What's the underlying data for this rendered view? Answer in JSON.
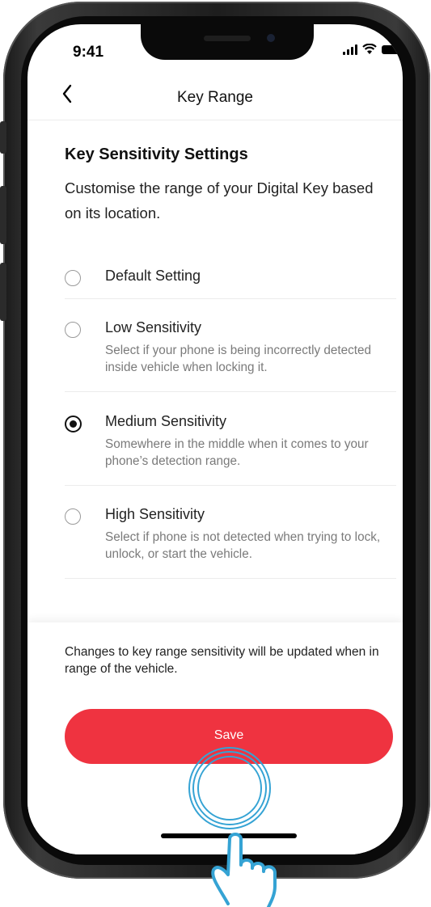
{
  "status_bar": {
    "time": "9:41"
  },
  "header": {
    "back_icon": "chevron-left-icon",
    "title": "Key Range"
  },
  "section": {
    "title": "Key Sensitivity Settings",
    "description": "Customise the range of your Digital Key based on its location."
  },
  "options": [
    {
      "title": "Default Setting",
      "description": "",
      "selected": false
    },
    {
      "title": "Low Sensitivity",
      "description": "Select if your phone is being incorrectly detected inside vehicle when locking it.",
      "selected": false
    },
    {
      "title": "Medium Sensitivity",
      "description": "Somewhere in the middle when it comes to your phone’s detection range.",
      "selected": true
    },
    {
      "title": "High Sensitivity",
      "description": "Select if phone is not detected when trying to lock, unlock, or start the vehicle.",
      "selected": false
    }
  ],
  "footer": {
    "note": "Changes to key range sensitivity will be updated when in range of the vehicle.",
    "save_label": "Save"
  },
  "colors": {
    "accent": "#ef3340",
    "touch_highlight": "#35a3d4"
  }
}
